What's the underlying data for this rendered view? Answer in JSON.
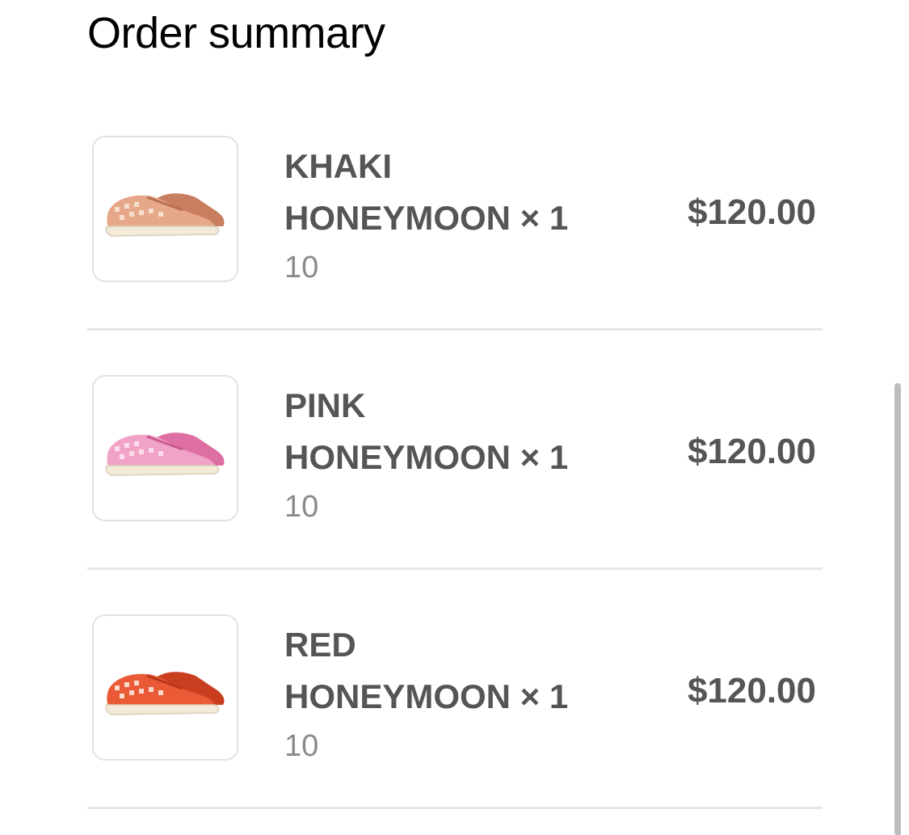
{
  "header": {
    "title": "Order summary"
  },
  "items": [
    {
      "line1": "KHAKI",
      "line2": "HONEYMOON × 1",
      "size": "10",
      "price": "$120.00",
      "color": "#e7a88a",
      "color_dark": "#c97e5f",
      "icon": "khaki-sneaker-image"
    },
    {
      "line1": "PINK",
      "line2": "HONEYMOON × 1",
      "size": "10",
      "price": "$120.00",
      "color": "#f0a3c6",
      "color_dark": "#dd6fa4",
      "icon": "pink-sneaker-image"
    },
    {
      "line1": "RED",
      "line2": "HONEYMOON × 1",
      "size": "10",
      "price": "$120.00",
      "color": "#ea5a36",
      "color_dark": "#c93e1f",
      "icon": "red-sneaker-image"
    }
  ]
}
